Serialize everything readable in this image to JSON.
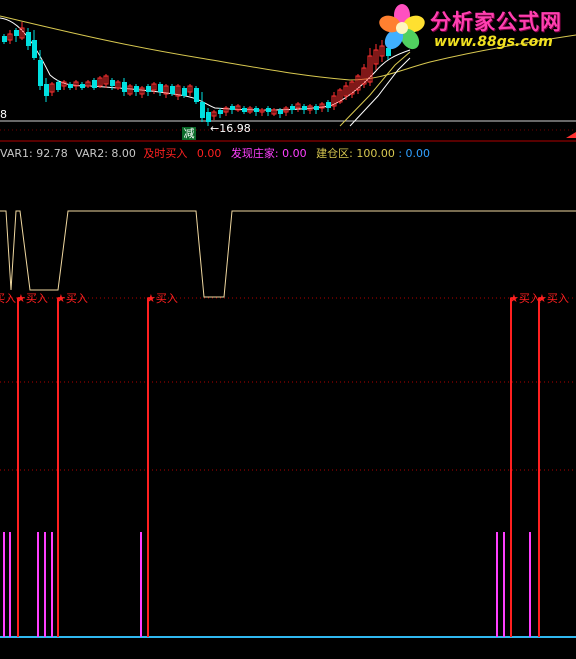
{
  "chart_data": [
    {
      "type": "candlestick",
      "panel": "price",
      "low_label": "16.98",
      "left_scale_label": "8",
      "marker_label": "减",
      "colors": {
        "up": "#ff3030",
        "down": "#00e0e0",
        "ma_long": "#d8c850",
        "ma_short": "#ffffff"
      }
    },
    {
      "type": "line",
      "panel": "indicator",
      "indicators": [
        {
          "name": "VAR1:",
          "value": "92.78",
          "color": "#c8c8c8"
        },
        {
          "name": "VAR2:",
          "value": "8.00",
          "color": "#c8c8c8"
        },
        {
          "name": "及时买入",
          "value": "0.00",
          "color": "#ff2020"
        },
        {
          "name": "发现庄家:",
          "value": "0.00",
          "color": "#ff40ff"
        },
        {
          "name": "建仓区:",
          "value": "100.00",
          "color": "#d8c850",
          "extra": ": 0.00",
          "extra_color": "#30a0ff"
        }
      ],
      "buy_signal_text": "买入",
      "signal_star": "★",
      "colors": {
        "buy": "#ff2020",
        "zhuang": "#ff40ff",
        "jiancang": "#f0d8a0",
        "base": "#30b8f0"
      }
    }
  ],
  "logo": {
    "title": "分析家公式网",
    "url": "www.88gs.com"
  }
}
